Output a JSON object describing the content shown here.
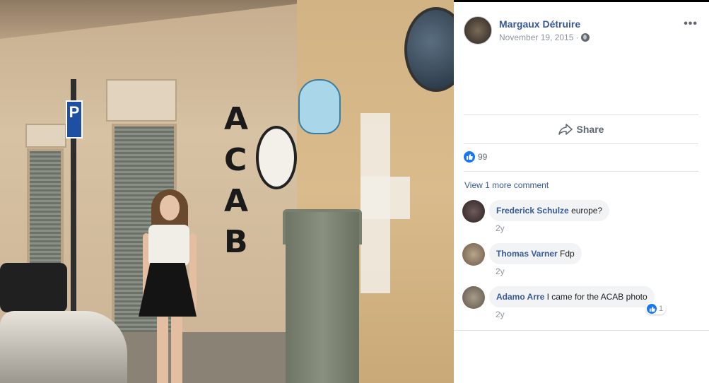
{
  "post": {
    "author": "Margaux Détruire",
    "date": "November 19, 2015",
    "date_separator": "·",
    "privacy_icon": "globe-icon",
    "more_label": "•••"
  },
  "actions": {
    "share_label": "Share",
    "share_icon": "share-arrow-icon"
  },
  "reactions": {
    "like_count": "99",
    "icon": "like-thumb-icon"
  },
  "comments_section": {
    "view_more": "View 1 more comment",
    "items": [
      {
        "name": "Frederick Schulze",
        "text": "europe?",
        "time": "2y"
      },
      {
        "name": "Thomas Varner",
        "text": "Fdp",
        "time": "2y"
      },
      {
        "name": "Adamo Arre",
        "text": "I came for the ACAB photo",
        "time": "2y",
        "reaction_count": "1"
      }
    ]
  },
  "photo": {
    "graffiti_acab": "ACAB",
    "parking_sign": "P"
  },
  "colors": {
    "link": "#385898",
    "meta": "#90949c",
    "like_blue": "#1877f2",
    "comment_bg": "#f2f3f5"
  }
}
